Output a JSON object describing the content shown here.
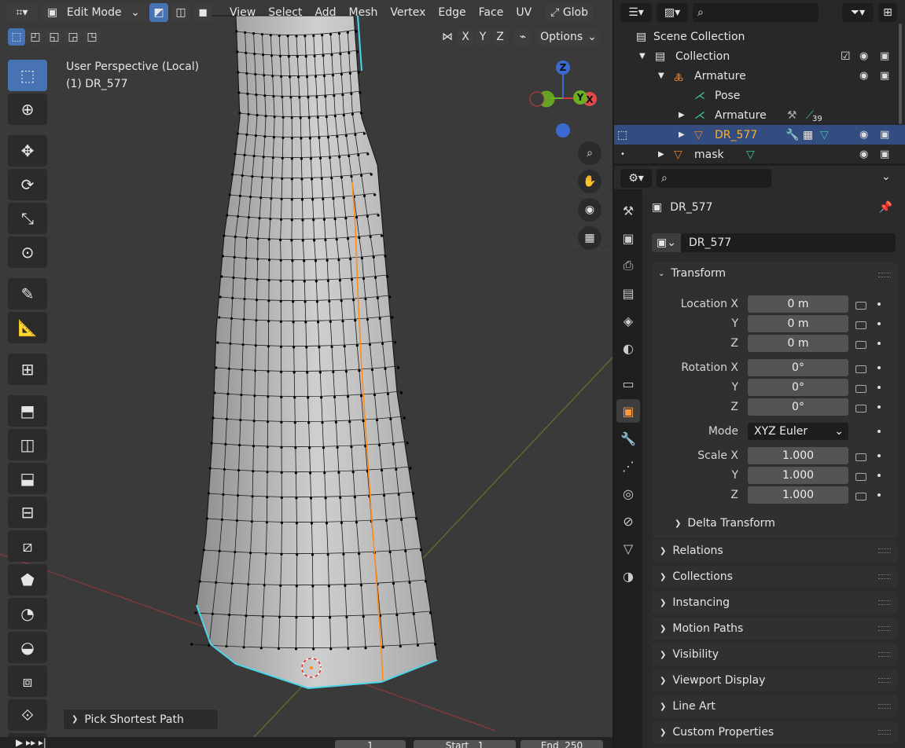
{
  "header": {
    "mode": "Edit Mode",
    "menus": [
      "View",
      "Select",
      "Add",
      "Mesh",
      "Vertex",
      "Edge",
      "Face",
      "UV"
    ],
    "orientation": "Glob",
    "axes": [
      "X",
      "Y",
      "Z"
    ],
    "options": "Options"
  },
  "viewport": {
    "perspective": "User Perspective (Local)",
    "object": "(1) DR_577",
    "operator": "Pick Shortest Path",
    "gizmo": {
      "z": "Z",
      "y": "Y",
      "x": "X"
    }
  },
  "timeline": {
    "frame": "1",
    "start_label": "Start",
    "start": "1",
    "end_label": "End",
    "end": "250"
  },
  "outliner": {
    "scene": "Scene Collection",
    "collection": "Collection",
    "items": [
      {
        "name": "Armature",
        "type": "armature"
      },
      {
        "name": "Pose",
        "type": "pose"
      },
      {
        "name": "Armature",
        "type": "armature-data",
        "badge": "39"
      },
      {
        "name": "DR_577",
        "type": "mesh",
        "selected": true
      },
      {
        "name": "mask",
        "type": "mesh"
      }
    ]
  },
  "properties": {
    "object_name": "DR_577",
    "datablock": "DR_577",
    "transform": {
      "title": "Transform",
      "location_label": "Location X",
      "rotation_label": "Rotation X",
      "scale_label": "Scale X",
      "y": "Y",
      "z": "Z",
      "location": [
        "0 m",
        "0 m",
        "0 m"
      ],
      "rotation": [
        "0°",
        "0°",
        "0°"
      ],
      "mode_label": "Mode",
      "mode": "XYZ Euler",
      "scale": [
        "1.000",
        "1.000",
        "1.000"
      ],
      "delta": "Delta Transform"
    },
    "panels": [
      "Relations",
      "Collections",
      "Instancing",
      "Motion Paths",
      "Visibility",
      "Viewport Display",
      "Line Art",
      "Custom Properties"
    ]
  },
  "colors": {
    "accent": "#4772b3",
    "selected_text": "#ffaf29",
    "edge_select": "#ff8c1a",
    "seam": "#4ad6e8"
  }
}
